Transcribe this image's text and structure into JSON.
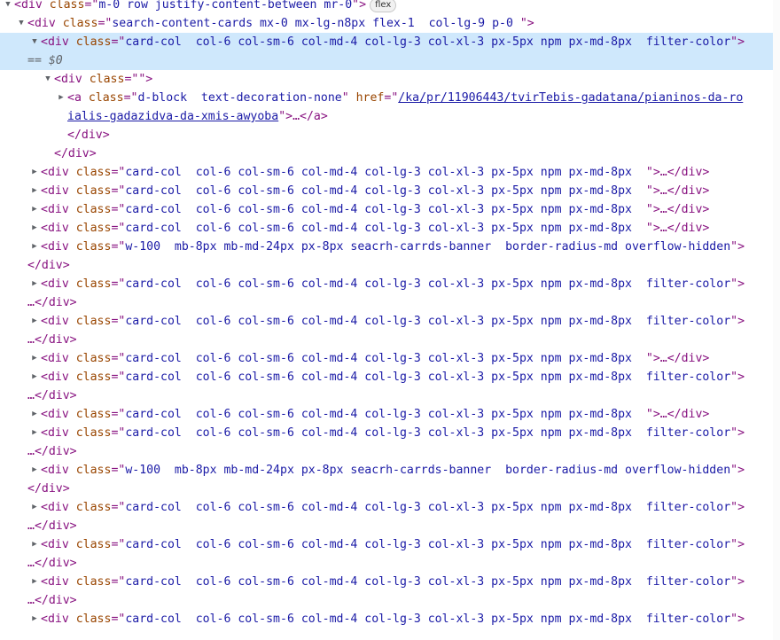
{
  "badge": "flex",
  "glyph": {
    "expanded": "▼",
    "collapsed": "▶"
  },
  "lines": [
    {
      "indent": 0,
      "toggle": "expanded",
      "tag": "div",
      "attrs": [
        {
          "n": "class",
          "v": "m-0 row justify-content-between mr-0"
        }
      ],
      "end": ">",
      "badge": true
    },
    {
      "indent": 1,
      "toggle": "expanded",
      "tag": "div",
      "attrs": [
        {
          "n": "class",
          "v": "search-content-cards mx-0 mx-lg-n8px flex-1  col-lg-9 p-0 "
        }
      ],
      "end": ">"
    },
    {
      "indent": 2,
      "toggle": "expanded",
      "tag": "div",
      "attrs": [
        {
          "n": "class",
          "v": "card-col  col-6 col-sm-6 col-md-4 col-lg-3 col-xl-3 px-5px npm px-md-8px  filter-color"
        }
      ],
      "end": ">",
      "selected": true
    },
    {
      "indent": 1,
      "cont": "== $0",
      "selected": true
    },
    {
      "indent": 3,
      "toggle": "expanded",
      "tag": "div",
      "attrs": [
        {
          "n": "class",
          "v": ""
        }
      ],
      "end": ">"
    },
    {
      "indent": 4,
      "toggle": "collapsed",
      "tag": "a",
      "attrs": [
        {
          "n": "class",
          "v": "d-block  text-decoration-none"
        },
        {
          "n": "href",
          "v": "/ka/pr/11906443/tvirTebis-gadatana/pianinos-da-ro",
          "link": true
        }
      ],
      "end": ""
    },
    {
      "indent": 4,
      "linkcont": "ialis-gadazidva-da-xmis-awyoba",
      "tail": "\">…</a>"
    },
    {
      "indent": 4,
      "close": "</div>"
    },
    {
      "indent": 3,
      "close": "</div>"
    },
    {
      "indent": 2,
      "toggle": "collapsed",
      "tag": "div",
      "attrs": [
        {
          "n": "class",
          "v": "card-col  col-6 col-sm-6 col-md-4 col-lg-3 col-xl-3 px-5px npm px-md-8px  "
        }
      ],
      "end": ">…</div>"
    },
    {
      "indent": 2,
      "toggle": "collapsed",
      "tag": "div",
      "attrs": [
        {
          "n": "class",
          "v": "card-col  col-6 col-sm-6 col-md-4 col-lg-3 col-xl-3 px-5px npm px-md-8px  "
        }
      ],
      "end": ">…</div>"
    },
    {
      "indent": 2,
      "toggle": "collapsed",
      "tag": "div",
      "attrs": [
        {
          "n": "class",
          "v": "card-col  col-6 col-sm-6 col-md-4 col-lg-3 col-xl-3 px-5px npm px-md-8px  "
        }
      ],
      "end": ">…</div>"
    },
    {
      "indent": 2,
      "toggle": "collapsed",
      "tag": "div",
      "attrs": [
        {
          "n": "class",
          "v": "card-col  col-6 col-sm-6 col-md-4 col-lg-3 col-xl-3 px-5px npm px-md-8px  "
        }
      ],
      "end": ">…</div>"
    },
    {
      "indent": 2,
      "toggle": "collapsed",
      "tag": "div",
      "attrs": [
        {
          "n": "class",
          "v": "w-100  mb-8px mb-md-24px px-8px seacrh-carrds-banner  border-radius-md overflow-hidden"
        }
      ],
      "end": ">"
    },
    {
      "indent": 1,
      "close": "</div>"
    },
    {
      "indent": 2,
      "toggle": "collapsed",
      "tag": "div",
      "attrs": [
        {
          "n": "class",
          "v": "card-col  col-6 col-sm-6 col-md-4 col-lg-3 col-xl-3 px-5px npm px-md-8px  filter-color"
        }
      ],
      "end": ">"
    },
    {
      "indent": 1,
      "close": "…</div>"
    },
    {
      "indent": 2,
      "toggle": "collapsed",
      "tag": "div",
      "attrs": [
        {
          "n": "class",
          "v": "card-col  col-6 col-sm-6 col-md-4 col-lg-3 col-xl-3 px-5px npm px-md-8px  filter-color"
        }
      ],
      "end": ">"
    },
    {
      "indent": 1,
      "close": "…</div>"
    },
    {
      "indent": 2,
      "toggle": "collapsed",
      "tag": "div",
      "attrs": [
        {
          "n": "class",
          "v": "card-col  col-6 col-sm-6 col-md-4 col-lg-3 col-xl-3 px-5px npm px-md-8px  "
        }
      ],
      "end": ">…</div>"
    },
    {
      "indent": 2,
      "toggle": "collapsed",
      "tag": "div",
      "attrs": [
        {
          "n": "class",
          "v": "card-col  col-6 col-sm-6 col-md-4 col-lg-3 col-xl-3 px-5px npm px-md-8px  filter-color"
        }
      ],
      "end": ">"
    },
    {
      "indent": 1,
      "close": "…</div>"
    },
    {
      "indent": 2,
      "toggle": "collapsed",
      "tag": "div",
      "attrs": [
        {
          "n": "class",
          "v": "card-col  col-6 col-sm-6 col-md-4 col-lg-3 col-xl-3 px-5px npm px-md-8px  "
        }
      ],
      "end": ">…</div>"
    },
    {
      "indent": 2,
      "toggle": "collapsed",
      "tag": "div",
      "attrs": [
        {
          "n": "class",
          "v": "card-col  col-6 col-sm-6 col-md-4 col-lg-3 col-xl-3 px-5px npm px-md-8px  filter-color"
        }
      ],
      "end": ">"
    },
    {
      "indent": 1,
      "close": "…</div>"
    },
    {
      "indent": 2,
      "toggle": "collapsed",
      "tag": "div",
      "attrs": [
        {
          "n": "class",
          "v": "w-100  mb-8px mb-md-24px px-8px seacrh-carrds-banner  border-radius-md overflow-hidden"
        }
      ],
      "end": ">"
    },
    {
      "indent": 1,
      "close": "</div>"
    },
    {
      "indent": 2,
      "toggle": "collapsed",
      "tag": "div",
      "attrs": [
        {
          "n": "class",
          "v": "card-col  col-6 col-sm-6 col-md-4 col-lg-3 col-xl-3 px-5px npm px-md-8px  filter-color"
        }
      ],
      "end": ">"
    },
    {
      "indent": 1,
      "close": "…</div>"
    },
    {
      "indent": 2,
      "toggle": "collapsed",
      "tag": "div",
      "attrs": [
        {
          "n": "class",
          "v": "card-col  col-6 col-sm-6 col-md-4 col-lg-3 col-xl-3 px-5px npm px-md-8px  filter-color"
        }
      ],
      "end": ">"
    },
    {
      "indent": 1,
      "close": "…</div>"
    },
    {
      "indent": 2,
      "toggle": "collapsed",
      "tag": "div",
      "attrs": [
        {
          "n": "class",
          "v": "card-col  col-6 col-sm-6 col-md-4 col-lg-3 col-xl-3 px-5px npm px-md-8px  filter-color"
        }
      ],
      "end": ">"
    },
    {
      "indent": 1,
      "close": "…</div>"
    },
    {
      "indent": 2,
      "toggle": "collapsed",
      "tag": "div",
      "attrs": [
        {
          "n": "class",
          "v": "card-col  col-6 col-sm-6 col-md-4 col-lg-3 col-xl-3 px-5px npm px-md-8px  filter-color"
        }
      ],
      "end": ">"
    }
  ]
}
